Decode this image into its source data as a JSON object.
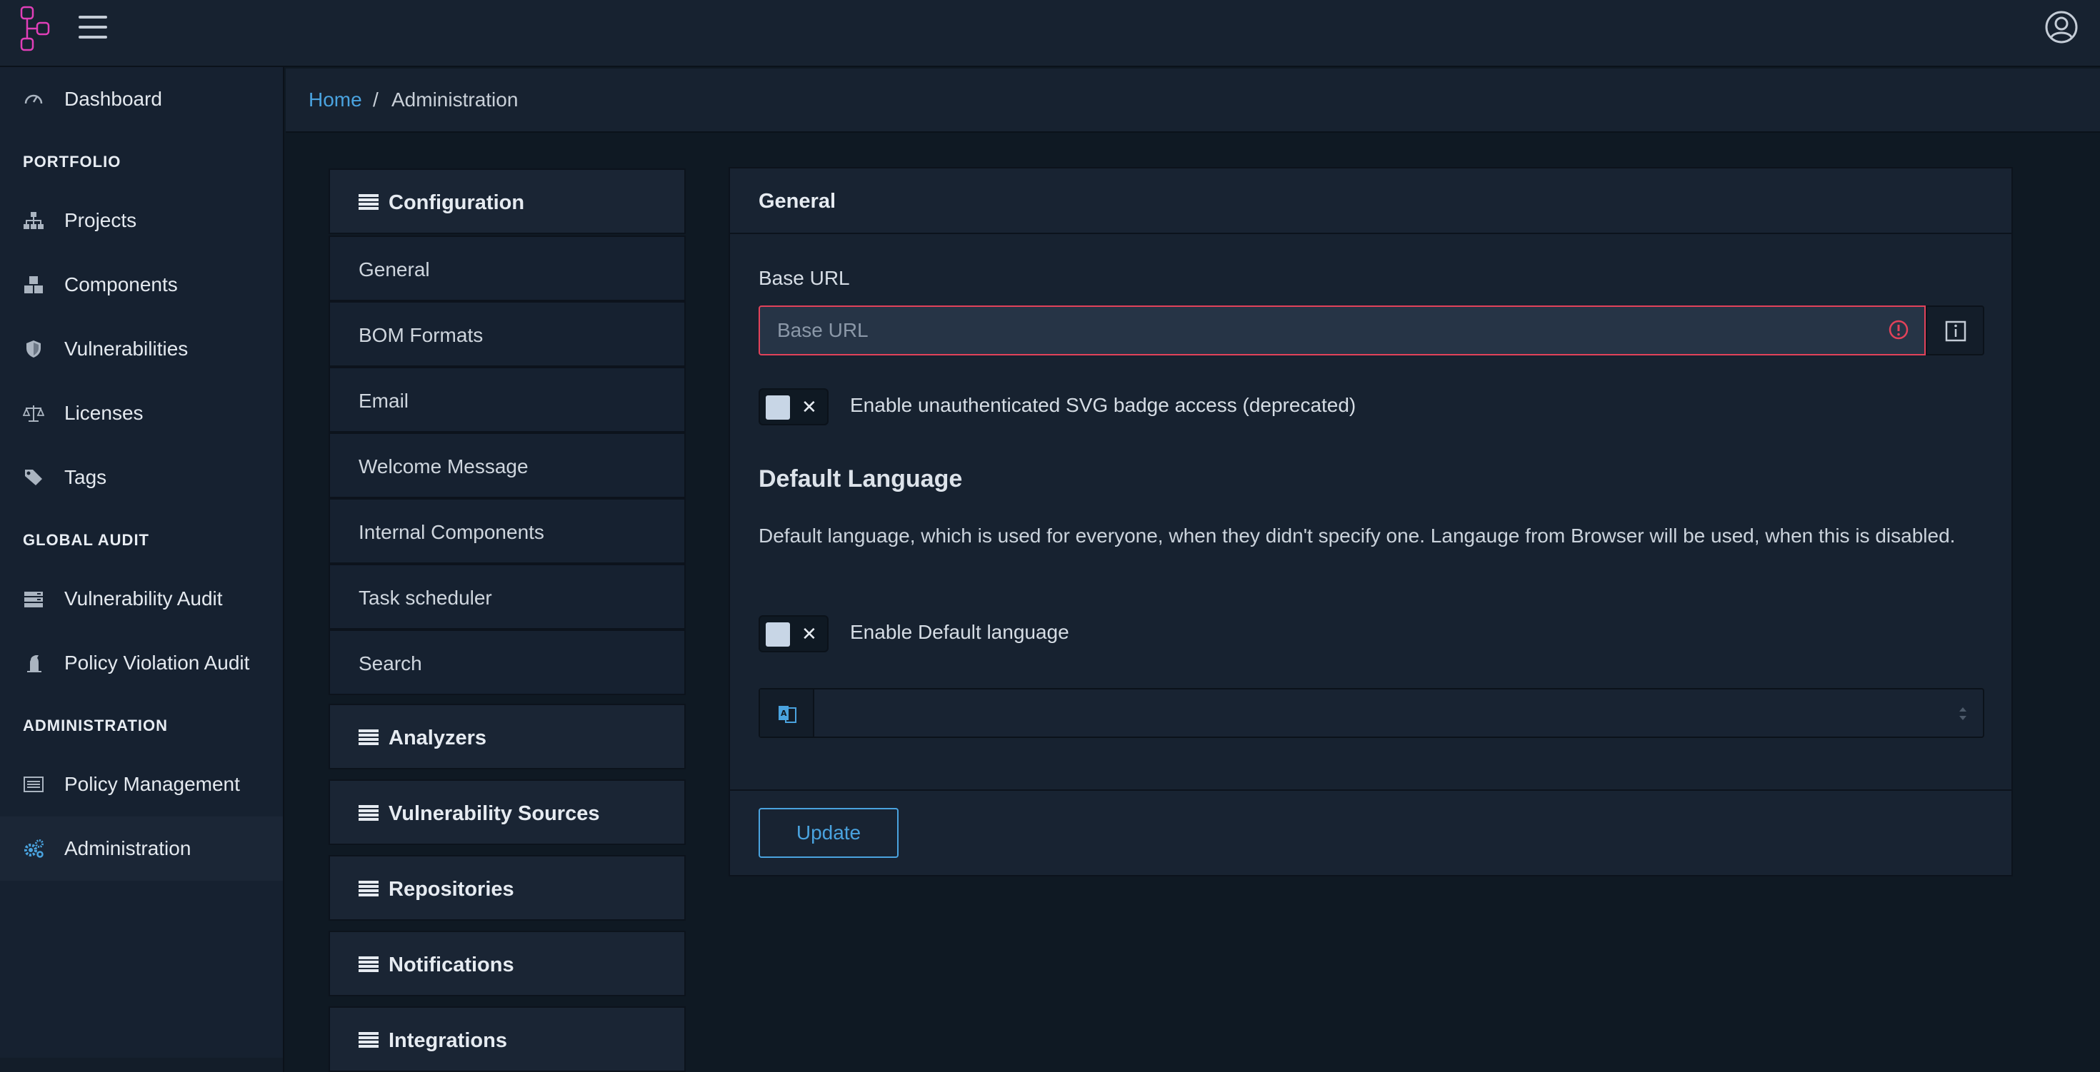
{
  "topbar": {
    "logo": "dependency-track-logo",
    "menu_icon": "hamburger-icon",
    "user_icon": "user-circle-icon"
  },
  "sidebar": {
    "dashboard": "Dashboard",
    "section_portfolio": "PORTFOLIO",
    "projects": "Projects",
    "components": "Components",
    "vulnerabilities": "Vulnerabilities",
    "licenses": "Licenses",
    "tags": "Tags",
    "section_global_audit": "GLOBAL AUDIT",
    "vulnerability_audit": "Vulnerability Audit",
    "policy_violation_audit": "Policy Violation Audit",
    "section_administration": "ADMINISTRATION",
    "policy_management": "Policy Management",
    "administration": "Administration",
    "active_item": "Administration",
    "active_color": "#4aa3df"
  },
  "breadcrumb": {
    "home": "Home",
    "separator": "/",
    "current": "Administration"
  },
  "config_menu": {
    "configuration": "Configuration",
    "items": [
      "General",
      "BOM Formats",
      "Email",
      "Welcome Message",
      "Internal Components",
      "Task scheduler",
      "Search"
    ],
    "analyzers": "Analyzers",
    "vulnerability_sources": "Vulnerability Sources",
    "repositories": "Repositories",
    "notifications": "Notifications",
    "integrations": "Integrations"
  },
  "general": {
    "title": "General",
    "base_url_label": "Base URL",
    "base_url_value": "",
    "base_url_placeholder": "Base URL",
    "error_color": "#e2425a",
    "svg_badge_toggle_label": "Enable unauthenticated SVG badge access (deprecated)",
    "svg_badge_enabled": false,
    "default_language_title": "Default Language",
    "default_language_description": "Default language, which is used for everyone, when they didn't specify one. Langauge from Browser will be used, when this is disabled.",
    "default_language_toggle_label": "Enable Default language",
    "default_language_enabled": false,
    "language_select_value": "",
    "update_button": "Update",
    "toggle_off_mark": "✕"
  }
}
